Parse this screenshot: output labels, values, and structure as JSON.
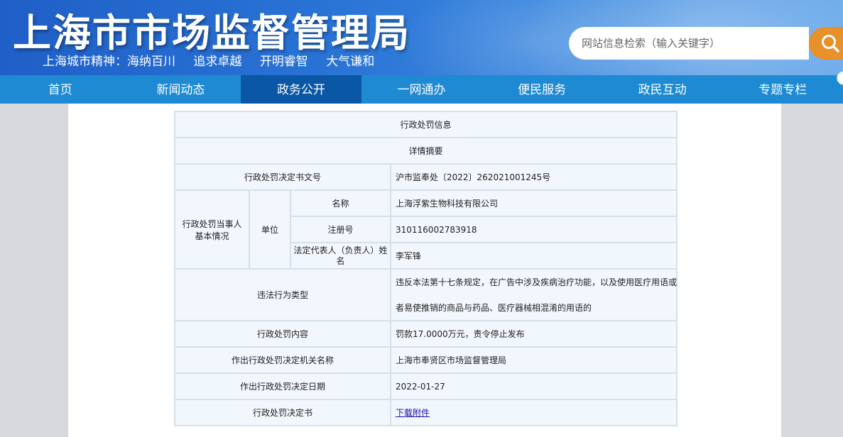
{
  "header": {
    "site_title": "上海市市场监督管理局",
    "slogan": [
      "上海城市精神：海纳百川",
      "追求卓越",
      "开明睿智",
      "大气谦和"
    ],
    "search_placeholder": "网站信息检索（输入关键字）",
    "search_icon": "search-icon",
    "accent_color": "#e8902a"
  },
  "nav": {
    "items": [
      "首页",
      "新闻动态",
      "政务公开",
      "一网通办",
      "便民服务",
      "政民互动",
      "专题专栏"
    ],
    "active": "政务公开"
  },
  "record": {
    "title": "行政处罚信息",
    "summary_heading": "详情摘要",
    "doc_no_label": "行政处罚决定书文号",
    "doc_no": "沪市监奉处〔2022〕262021001245号",
    "party_label": "行政处罚当事人基本情况",
    "unit_label": "单位",
    "name_label": "名称",
    "name": "上海浮紫生物科技有限公司",
    "reg_label": "注册号",
    "reg_no": "310116002783918",
    "rep_label": "法定代表人（负责人）姓名",
    "rep": "李军锋",
    "violation_label": "违法行为类型",
    "violation_line1": "违反本法第十七条规定，在广告中涉及疾病治疗功能，以及使用医疗用语或",
    "violation_line2": "者易使推销的商品与药品、医疗器械相混淆的用语的",
    "penalty_label": "行政处罚内容",
    "penalty": "罚款17.0000万元，责令停止发布",
    "authority_label": "作出行政处罚决定机关名称",
    "authority": "上海市奉贤区市场监督管理局",
    "date_label": "作出行政处罚决定日期",
    "date": "2022-01-27",
    "decision_label": "行政处罚决定书",
    "decision_link": "下载附件"
  }
}
